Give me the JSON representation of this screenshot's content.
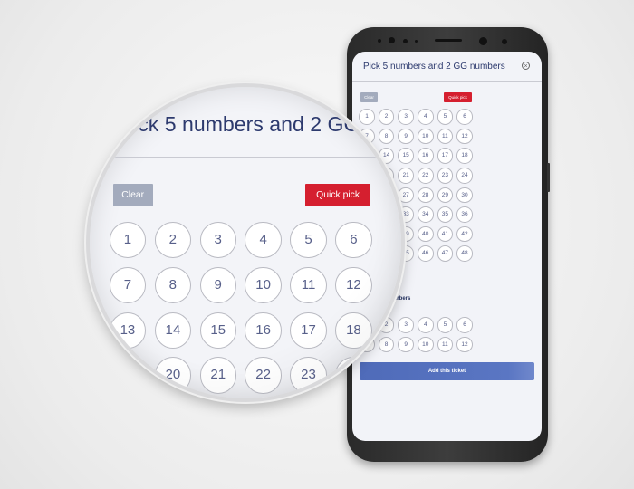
{
  "modal": {
    "title": "Pick 5 numbers and 2 GG numbers",
    "close_icon": "close-circle-icon",
    "clear_label": "Clear",
    "quick_pick_label": "Quick pick",
    "main_numbers": [
      1,
      2,
      3,
      4,
      5,
      6,
      7,
      8,
      9,
      10,
      11,
      12,
      13,
      14,
      15,
      16,
      17,
      18,
      19,
      20,
      21,
      22,
      23,
      24,
      25,
      26,
      27,
      28,
      29,
      30,
      31,
      32,
      33,
      34,
      35,
      36,
      37,
      38,
      39,
      40,
      41,
      42,
      43,
      44,
      45,
      46,
      47,
      48,
      49,
      50
    ],
    "gg_title": "Pick 2 GG numbers",
    "gg_numbers": [
      1,
      2,
      3,
      4,
      5,
      6,
      7,
      8,
      9,
      10,
      11,
      12
    ],
    "add_ticket_label": "Add this ticket"
  },
  "colors": {
    "accent": "#5571c0",
    "quick_pick": "#d51f2f",
    "clear": "#a3abbd",
    "title": "#2d3a6e"
  }
}
